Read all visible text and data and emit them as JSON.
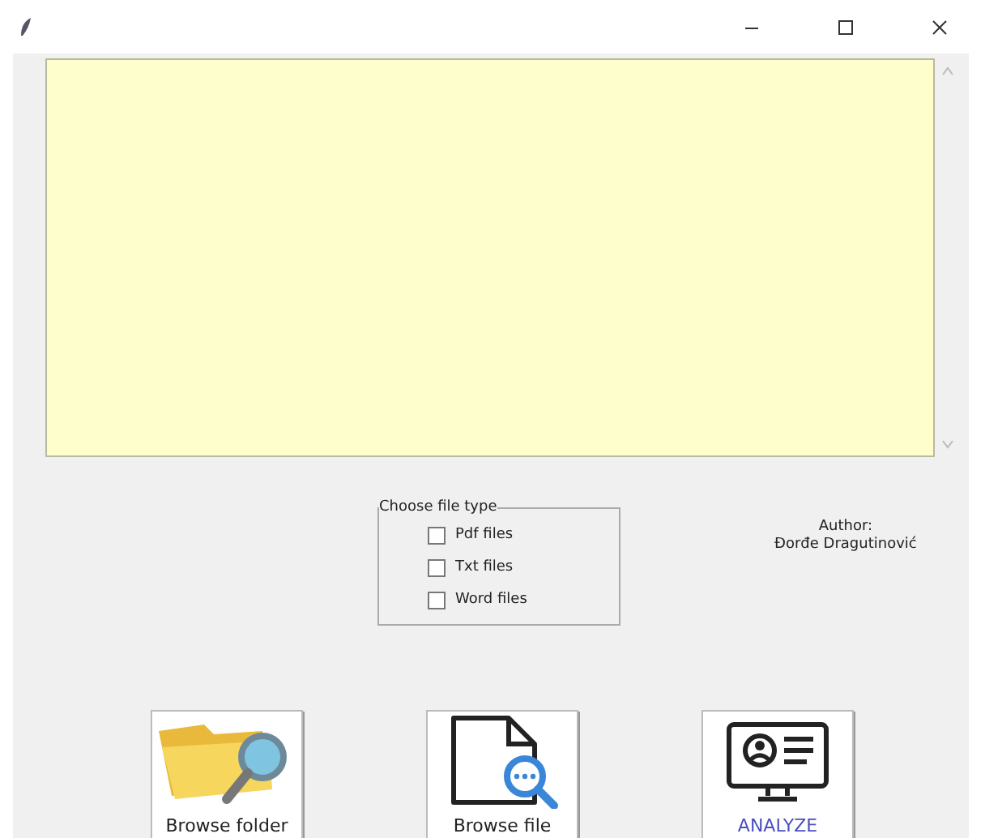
{
  "group": {
    "title": "Choose file type",
    "options": [
      {
        "label": "Pdf files",
        "checked": false
      },
      {
        "label": "Txt files",
        "checked": false
      },
      {
        "label": "Word files",
        "checked": false
      }
    ]
  },
  "author": {
    "label": "Author:",
    "name": "Đorđe Dragutinović"
  },
  "buttons": [
    {
      "kind": "folder",
      "label": "Browse folder"
    },
    {
      "kind": "file",
      "label": "Browse file"
    },
    {
      "kind": "analyze",
      "label": "ANALYZE"
    }
  ]
}
